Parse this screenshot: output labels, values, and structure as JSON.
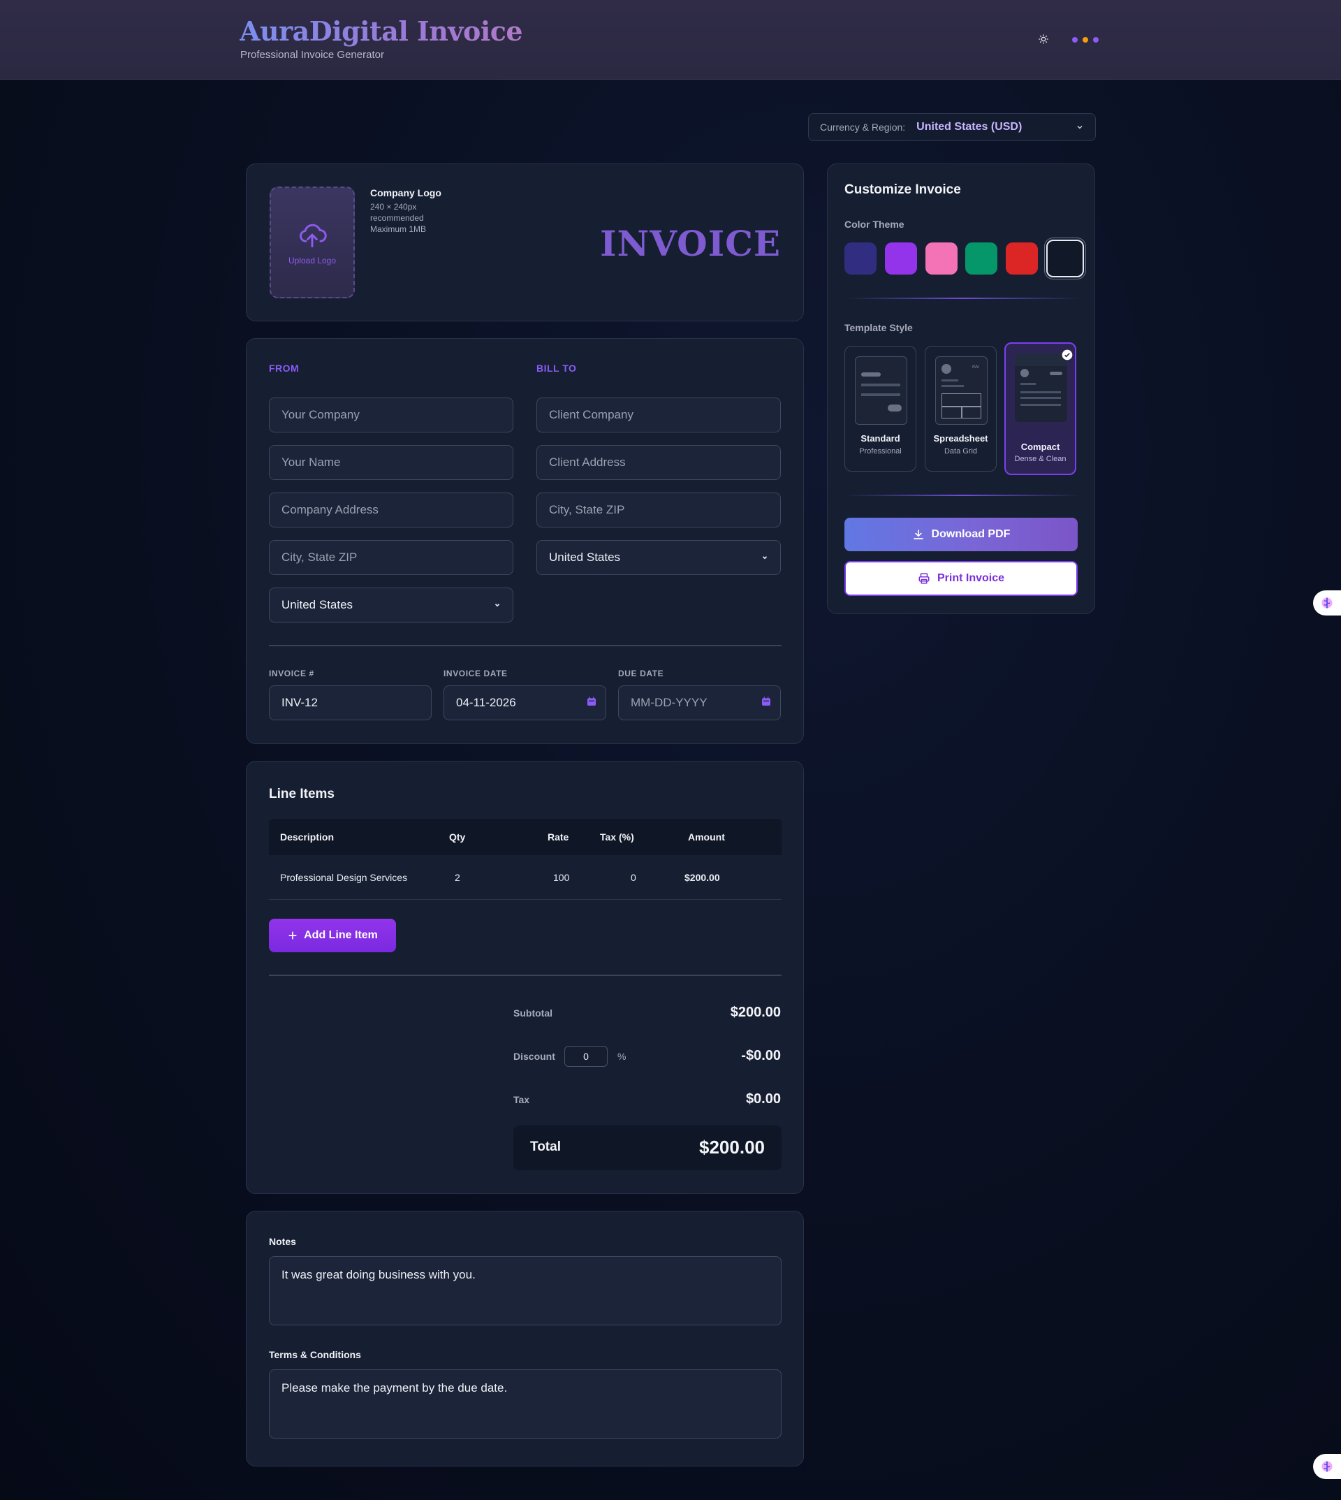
{
  "header": {
    "brand": "AuraDigital Invoice",
    "subtitle": "Professional Invoice Generator",
    "theme_icon": "sun-icon",
    "dot_colors": [
      "#8b5cf6",
      "#f59e0b",
      "#8b5cf6"
    ]
  },
  "currency": {
    "label": "Currency & Region:",
    "value": "United States (USD)"
  },
  "logo": {
    "upload_label": "Upload Logo",
    "title": "Company Logo",
    "line1": "240 × 240px",
    "line2": "recommended",
    "line3": "Maximum 1MB"
  },
  "invoice_heading": "INVOICE",
  "from": {
    "label": "FROM",
    "company_placeholder": "Your Company",
    "name_placeholder": "Your Name",
    "address_placeholder": "Company Address",
    "city_placeholder": "City, State ZIP",
    "country": "United States"
  },
  "bill_to": {
    "label": "BILL TO",
    "company_placeholder": "Client Company",
    "address_placeholder": "Client Address",
    "city_placeholder": "City, State ZIP",
    "country": "United States"
  },
  "meta": {
    "number_label": "INVOICE #",
    "number_value": "INV-12",
    "date_label": "INVOICE DATE",
    "date_value": "04-11-2026",
    "due_label": "DUE DATE",
    "due_placeholder": "MM-DD-YYYY"
  },
  "line_items": {
    "title": "Line Items",
    "columns": [
      "Description",
      "Qty",
      "Rate",
      "Tax (%)",
      "Amount"
    ],
    "rows": [
      {
        "description": "Professional Design Services",
        "qty": "2",
        "rate": "100",
        "tax": "0",
        "amount": "$200.00"
      }
    ],
    "add_label": "Add Line Item"
  },
  "summary": {
    "subtotal_label": "Subtotal",
    "subtotal_value": "$200.00",
    "discount_label": "Discount",
    "discount_input": "0",
    "discount_unit": "%",
    "discount_value": "-$0.00",
    "tax_label": "Tax",
    "tax_value": "$0.00",
    "total_label": "Total",
    "total_value": "$200.00"
  },
  "notes": {
    "notes_label": "Notes",
    "notes_value": "It was great doing business with you.",
    "terms_label": "Terms & Conditions",
    "terms_value": "Please make the payment by the due date."
  },
  "customize": {
    "title": "Customize Invoice",
    "color_theme_label": "Color Theme",
    "swatches": [
      "#312e81",
      "#9333ea",
      "#f472b6",
      "#059669",
      "#dc2626",
      "#111827"
    ],
    "template_label": "Template Style",
    "templates": [
      {
        "name": "Standard",
        "desc": "Professional"
      },
      {
        "name": "Spreadsheet",
        "desc": "Data Grid"
      },
      {
        "name": "Compact",
        "desc": "Dense & Clean"
      }
    ],
    "download_label": "Download PDF",
    "print_label": "Print Invoice"
  }
}
